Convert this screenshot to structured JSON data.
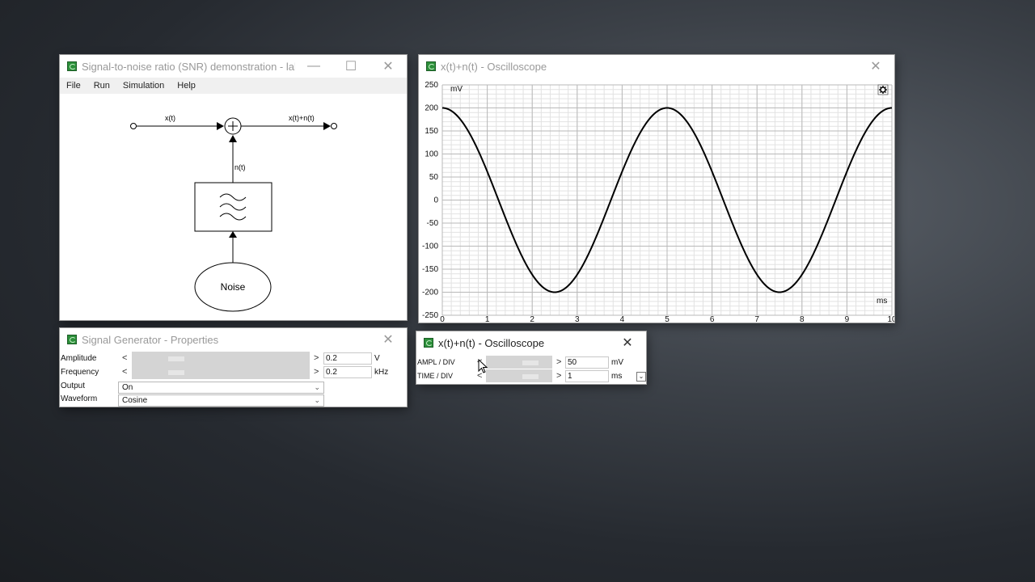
{
  "main_window": {
    "title": "Signal-to-noise ratio (SNR) demonstration - lab...",
    "menu": [
      "File",
      "Run",
      "Simulation",
      "Help"
    ],
    "diagram": {
      "input_label": "x(t)",
      "output_label": "x(t)+n(t)",
      "noise_label": "n(t)",
      "noise_block": "Noise"
    }
  },
  "props_window": {
    "title": "Signal Generator - Properties",
    "rows": [
      {
        "label": "Amplitude",
        "value": "0.2",
        "unit": "V"
      },
      {
        "label": "Frequency",
        "value": "0.2",
        "unit": "kHz"
      }
    ],
    "output": {
      "label": "Output",
      "value": "On"
    },
    "waveform": {
      "label": "Waveform",
      "value": "Cosine"
    }
  },
  "scope_window": {
    "title": "x(t)+n(t) - Oscilloscope",
    "y_unit": "mV",
    "x_unit": "ms",
    "settings_icon": "gear-icon"
  },
  "scope_ctl_window": {
    "title": "x(t)+n(t) - Oscilloscope",
    "ampl": {
      "label": "AMPL / DIV",
      "value": "50",
      "unit": "mV"
    },
    "time": {
      "label": "TIME / DIV",
      "value": "1",
      "unit": "ms"
    }
  },
  "chart_data": {
    "type": "line",
    "xlabel": "ms",
    "ylabel": "mV",
    "xlim": [
      0,
      10
    ],
    "ylim": [
      -250,
      250
    ],
    "x_ticks": [
      0,
      1,
      2,
      3,
      4,
      5,
      6,
      7,
      8,
      9,
      10
    ],
    "y_ticks": [
      250,
      200,
      150,
      100,
      50,
      0,
      -50,
      -100,
      -150,
      -200,
      -250
    ],
    "grid": true,
    "series": [
      {
        "amplitude": 200,
        "period_ms": 5,
        "phase": "cosine",
        "x": [
          0,
          0.5,
          1,
          1.5,
          2,
          2.5,
          3,
          3.5,
          4,
          4.5,
          5,
          5.5,
          6,
          6.5,
          7,
          7.5,
          8,
          8.5,
          9,
          9.5,
          10
        ],
        "values": [
          200,
          162,
          62,
          -62,
          -162,
          -200,
          -162,
          -62,
          62,
          162,
          200,
          162,
          62,
          -62,
          -162,
          -200,
          -162,
          -62,
          62,
          162,
          200
        ]
      }
    ]
  }
}
